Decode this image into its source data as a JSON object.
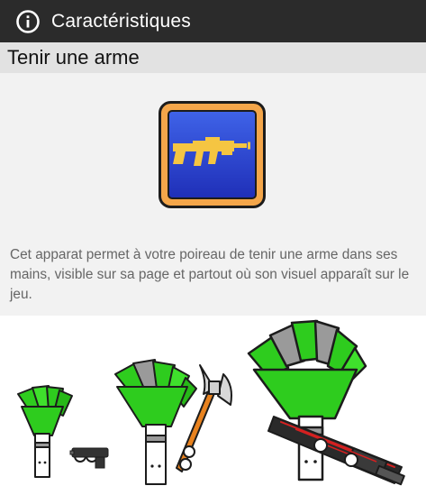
{
  "header": {
    "title": "Caractéristiques",
    "icon": "info-icon"
  },
  "section": {
    "title": "Tenir une arme"
  },
  "feature": {
    "icon": "weapon-icon",
    "description": "Cet apparat permet à votre poireau de tenir une arme dans ses mains, visible sur sa page et partout où son visuel apparaît sur le jeu."
  },
  "colors": {
    "header_bg": "#2b2b2b",
    "subheader_bg": "#e2e2e2",
    "content_bg": "#f2f2f2",
    "badge_blue": "#2a3fd6",
    "badge_frame": "#f4a64a",
    "weapon_gold": "#f5c542",
    "leek_green": "#2ecc1e"
  },
  "gallery": [
    {
      "name": "leek-with-pistol",
      "weapon": "pistol"
    },
    {
      "name": "leek-with-axe",
      "weapon": "axe"
    },
    {
      "name": "leek-with-rifle",
      "weapon": "rifle"
    }
  ]
}
